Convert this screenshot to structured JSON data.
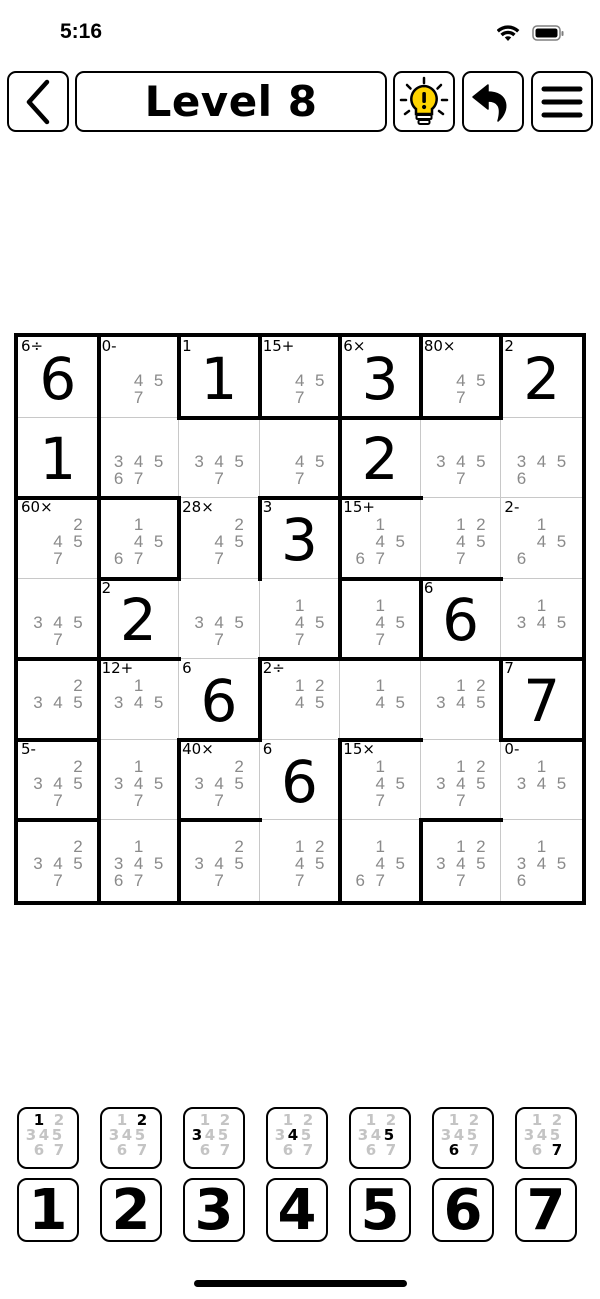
{
  "status_bar": {
    "time": "5:16"
  },
  "header": {
    "title": "Level 8"
  },
  "puzzle": {
    "size": 7,
    "cells": [
      [
        {
          "v": "6",
          "c": "6÷"
        },
        {
          "n": [
            4,
            5,
            7
          ],
          "c": "0-"
        },
        {
          "v": "1",
          "c": "1"
        },
        {
          "n": [
            4,
            5,
            7
          ],
          "c": "15+"
        },
        {
          "v": "3",
          "c": "6×"
        },
        {
          "n": [
            4,
            5,
            7
          ],
          "c": "80×"
        },
        {
          "v": "2",
          "c": "2"
        }
      ],
      [
        {
          "v": "1"
        },
        {
          "n": [
            3,
            4,
            5,
            6,
            7
          ]
        },
        {
          "n": [
            3,
            4,
            5,
            7
          ]
        },
        {
          "n": [
            4,
            5,
            7
          ]
        },
        {
          "v": "2"
        },
        {
          "n": [
            3,
            4,
            5,
            7
          ]
        },
        {
          "n": [
            3,
            4,
            5,
            6
          ]
        }
      ],
      [
        {
          "n": [
            2,
            4,
            5,
            7
          ],
          "c": "60×"
        },
        {
          "n": [
            1,
            4,
            5,
            6,
            7
          ]
        },
        {
          "n": [
            2,
            4,
            5,
            7
          ],
          "c": "28×"
        },
        {
          "v": "3",
          "c": "3"
        },
        {
          "n": [
            1,
            4,
            5,
            6,
            7
          ],
          "c": "15+"
        },
        {
          "n": [
            1,
            2,
            4,
            5,
            7
          ]
        },
        {
          "n": [
            1,
            4,
            5,
            6
          ],
          "c": "2-"
        }
      ],
      [
        {
          "n": [
            3,
            4,
            5,
            7
          ]
        },
        {
          "v": "2",
          "c": "2"
        },
        {
          "n": [
            3,
            4,
            5,
            7
          ]
        },
        {
          "n": [
            1,
            4,
            5,
            7
          ]
        },
        {
          "n": [
            1,
            4,
            5,
            7
          ]
        },
        {
          "v": "6",
          "c": "6"
        },
        {
          "n": [
            1,
            3,
            4,
            5
          ]
        }
      ],
      [
        {
          "n": [
            2,
            3,
            4,
            5
          ]
        },
        {
          "n": [
            1,
            3,
            4,
            5
          ],
          "c": "12+"
        },
        {
          "v": "6",
          "c": "6"
        },
        {
          "n": [
            1,
            2,
            4,
            5
          ],
          "c": "2÷"
        },
        {
          "n": [
            1,
            4,
            5
          ]
        },
        {
          "n": [
            1,
            2,
            3,
            4,
            5
          ]
        },
        {
          "v": "7",
          "c": "7"
        }
      ],
      [
        {
          "n": [
            2,
            3,
            4,
            5,
            7
          ],
          "c": "5-"
        },
        {
          "n": [
            1,
            3,
            4,
            5,
            7
          ]
        },
        {
          "n": [
            2,
            3,
            4,
            5,
            7
          ],
          "c": "40×"
        },
        {
          "v": "6",
          "c": "6"
        },
        {
          "n": [
            1,
            4,
            5,
            7
          ],
          "c": "15×"
        },
        {
          "n": [
            1,
            2,
            3,
            4,
            5,
            7
          ]
        },
        {
          "n": [
            1,
            3,
            4,
            5
          ],
          "c": "0-"
        }
      ],
      [
        {
          "n": [
            2,
            3,
            4,
            5,
            7
          ]
        },
        {
          "n": [
            1,
            3,
            4,
            5,
            6,
            7
          ]
        },
        {
          "n": [
            2,
            3,
            4,
            5,
            7
          ]
        },
        {
          "n": [
            1,
            2,
            4,
            5,
            7
          ]
        },
        {
          "n": [
            1,
            4,
            5,
            6,
            7
          ]
        },
        {
          "n": [
            1,
            2,
            3,
            4,
            5,
            7
          ]
        },
        {
          "n": [
            1,
            3,
            4,
            5,
            6
          ]
        }
      ]
    ]
  },
  "pad": {
    "note_digits": [
      1,
      2,
      3,
      4,
      5,
      6,
      7
    ],
    "numbers": [
      "1",
      "2",
      "3",
      "4",
      "5",
      "6",
      "7"
    ]
  }
}
